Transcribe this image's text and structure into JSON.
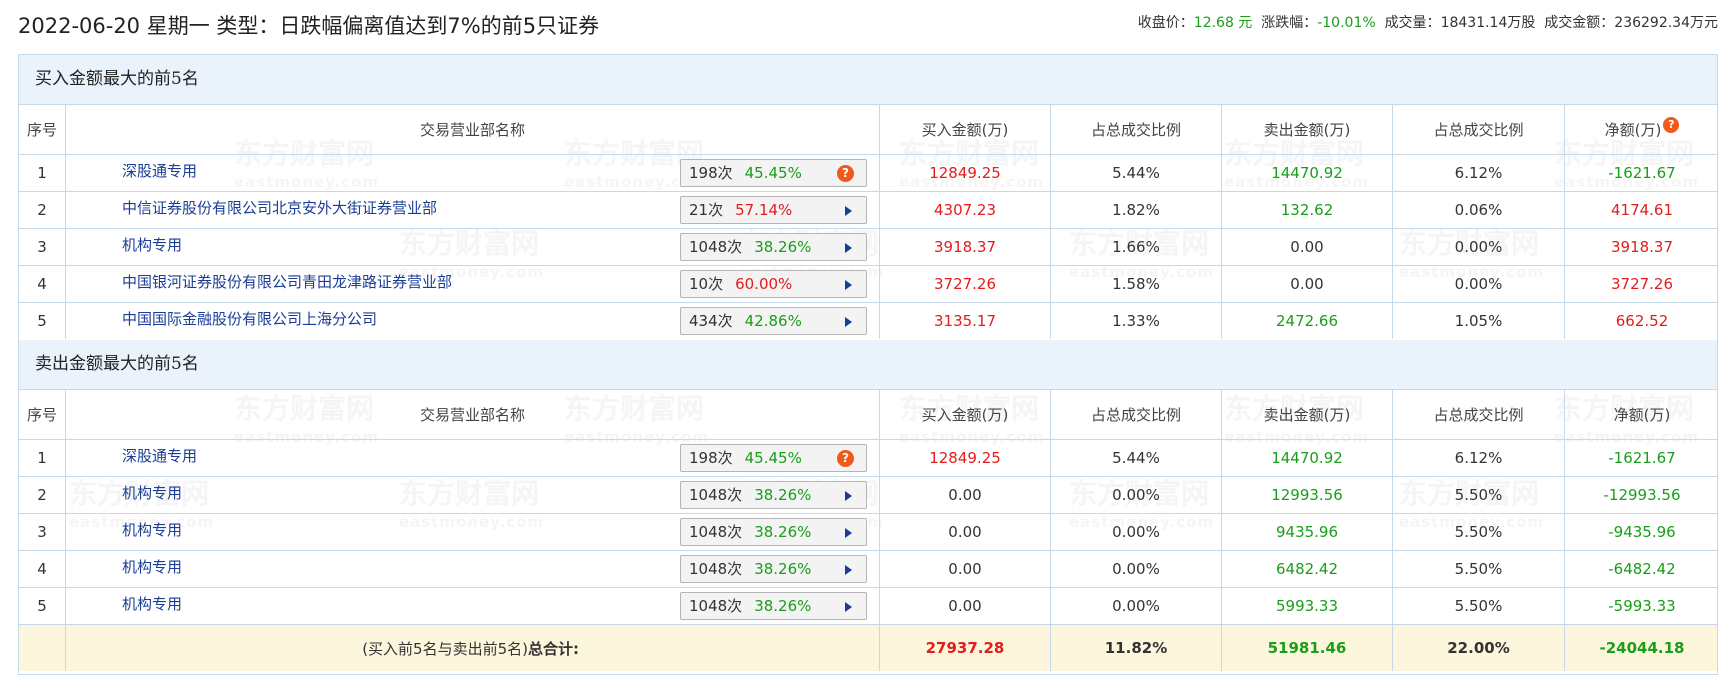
{
  "header": {
    "title": "2022-06-20 星期一 类型：日跌幅偏离值达到7%的前5只证券",
    "close_label": "收盘价：",
    "close_value": "12.68 元",
    "change_label": "涨跌幅：",
    "change_value": "-10.01%",
    "volume_label": "成交量：",
    "volume_value": "18431.14万股",
    "turnover_label": "成交金额：",
    "turnover_value": "236292.34万元"
  },
  "columns": [
    "序号",
    "交易营业部名称",
    "买入金额(万)",
    "占总成交比例",
    "卖出金额(万)",
    "占总成交比例",
    "净额(万)"
  ],
  "buy_section": {
    "title": "买入金额最大的前5名",
    "rows": [
      {
        "idx": "1",
        "name": "深股通专用",
        "count": "198次",
        "pct": "45.45%",
        "pct_color": "green",
        "icon": "question-icon",
        "buy": "12849.25",
        "buy_pct": "5.44%",
        "sell": "14470.92",
        "sell_pct": "6.12%",
        "net": "-1621.67"
      },
      {
        "idx": "2",
        "name": "中信证券股份有限公司北京安外大街证券营业部",
        "count": "21次",
        "pct": "57.14%",
        "pct_color": "red",
        "icon": "arrow-right-icon",
        "buy": "4307.23",
        "buy_pct": "1.82%",
        "sell": "132.62",
        "sell_pct": "0.06%",
        "net": "4174.61"
      },
      {
        "idx": "3",
        "name": "机构专用",
        "count": "1048次",
        "pct": "38.26%",
        "pct_color": "green",
        "icon": "arrow-right-icon",
        "buy": "3918.37",
        "buy_pct": "1.66%",
        "sell": "0.00",
        "sell_pct": "0.00%",
        "net": "3918.37"
      },
      {
        "idx": "4",
        "name": "中国银河证券股份有限公司青田龙津路证券营业部",
        "count": "10次",
        "pct": "60.00%",
        "pct_color": "red",
        "icon": "arrow-right-icon",
        "buy": "3727.26",
        "buy_pct": "1.58%",
        "sell": "0.00",
        "sell_pct": "0.00%",
        "net": "3727.26"
      },
      {
        "idx": "5",
        "name": "中国国际金融股份有限公司上海分公司",
        "count": "434次",
        "pct": "42.86%",
        "pct_color": "green",
        "icon": "arrow-right-icon",
        "buy": "3135.17",
        "buy_pct": "1.33%",
        "sell": "2472.66",
        "sell_pct": "1.05%",
        "net": "662.52"
      }
    ]
  },
  "sell_section": {
    "title": "卖出金额最大的前5名",
    "rows": [
      {
        "idx": "1",
        "name": "深股通专用",
        "count": "198次",
        "pct": "45.45%",
        "pct_color": "green",
        "icon": "question-icon",
        "buy": "12849.25",
        "buy_pct": "5.44%",
        "sell": "14470.92",
        "sell_pct": "6.12%",
        "net": "-1621.67"
      },
      {
        "idx": "2",
        "name": "机构专用",
        "count": "1048次",
        "pct": "38.26%",
        "pct_color": "green",
        "icon": "arrow-right-icon",
        "buy": "0.00",
        "buy_pct": "0.00%",
        "sell": "12993.56",
        "sell_pct": "5.50%",
        "net": "-12993.56"
      },
      {
        "idx": "3",
        "name": "机构专用",
        "count": "1048次",
        "pct": "38.26%",
        "pct_color": "green",
        "icon": "arrow-right-icon",
        "buy": "0.00",
        "buy_pct": "0.00%",
        "sell": "9435.96",
        "sell_pct": "5.50%",
        "net": "-9435.96"
      },
      {
        "idx": "4",
        "name": "机构专用",
        "count": "1048次",
        "pct": "38.26%",
        "pct_color": "green",
        "icon": "arrow-right-icon",
        "buy": "0.00",
        "buy_pct": "0.00%",
        "sell": "6482.42",
        "sell_pct": "5.50%",
        "net": "-6482.42"
      },
      {
        "idx": "5",
        "name": "机构专用",
        "count": "1048次",
        "pct": "38.26%",
        "pct_color": "green",
        "icon": "arrow-right-icon",
        "buy": "0.00",
        "buy_pct": "0.00%",
        "sell": "5993.33",
        "sell_pct": "5.50%",
        "net": "-5993.33"
      }
    ]
  },
  "total": {
    "label_prefix": "(买入前5名与卖出前5名)",
    "label_strong": "总合计:",
    "buy": "27937.28",
    "buy_pct": "11.82%",
    "sell": "51981.46",
    "sell_pct": "22.00%",
    "net": "-24044.18"
  },
  "watermark": {
    "brand": "东方财富网",
    "domain": "eastmoney.com"
  },
  "colors": {
    "up": "#e31c1c",
    "down": "#1a9e1a",
    "link": "#1a3d96",
    "section_bg": "#eaf3fb",
    "total_bg": "#fcf7dc",
    "border": "#c5d9e8",
    "icon": "#f05a1a"
  }
}
